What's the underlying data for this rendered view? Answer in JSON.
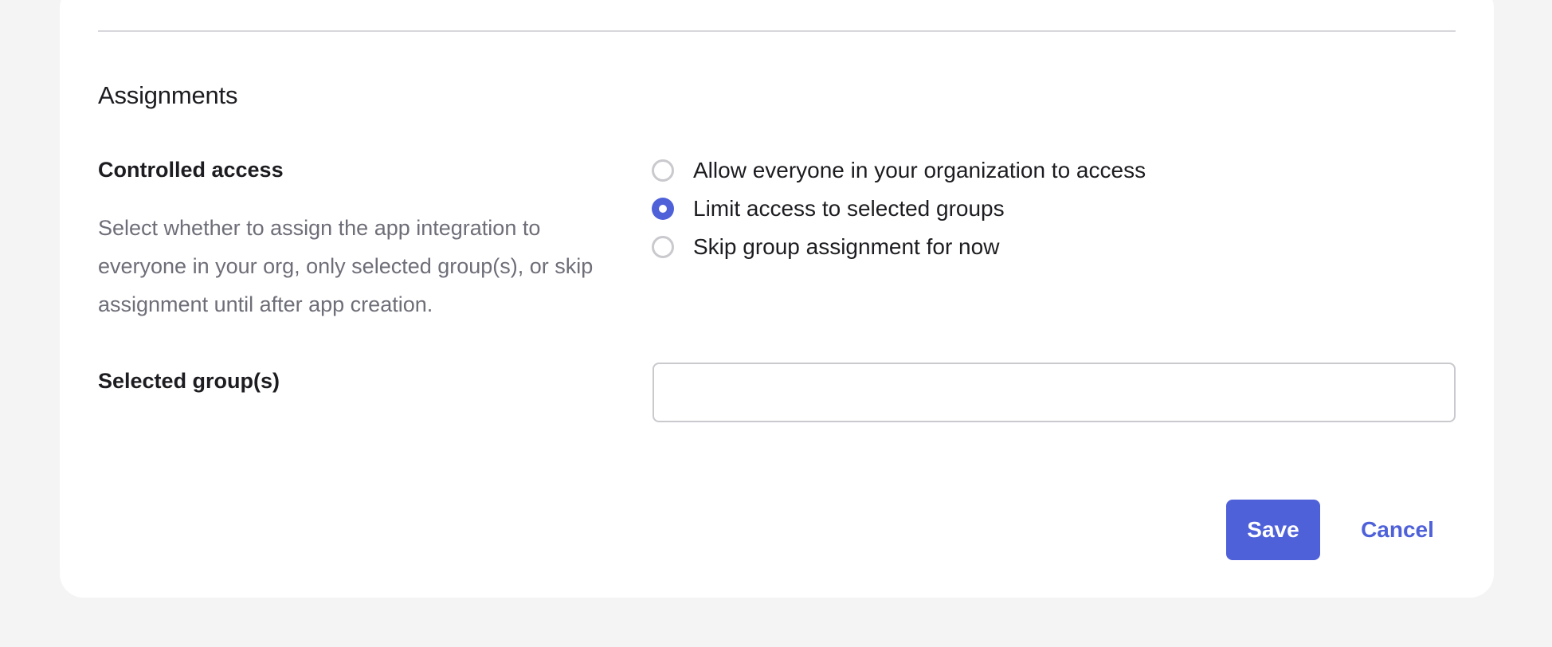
{
  "assignments": {
    "title": "Assignments",
    "controlled_access": {
      "label": "Controlled access",
      "description": "Select whether to assign the app integration to everyone in your org, only selected group(s), or skip assignment until after app creation.",
      "options": [
        {
          "label": "Allow everyone in your organization to access",
          "checked": false
        },
        {
          "label": "Limit access to selected groups",
          "checked": true
        },
        {
          "label": "Skip group assignment for now",
          "checked": false
        }
      ]
    },
    "selected_groups": {
      "label": "Selected group(s)",
      "value": "",
      "placeholder": ""
    }
  },
  "actions": {
    "save_label": "Save",
    "cancel_label": "Cancel"
  },
  "colors": {
    "accent": "#4f61d9",
    "background": "#f4f4f4",
    "card": "#ffffff",
    "text": "#1d1d21",
    "muted_text": "#6e6e78",
    "border": "#c9c9ce"
  }
}
